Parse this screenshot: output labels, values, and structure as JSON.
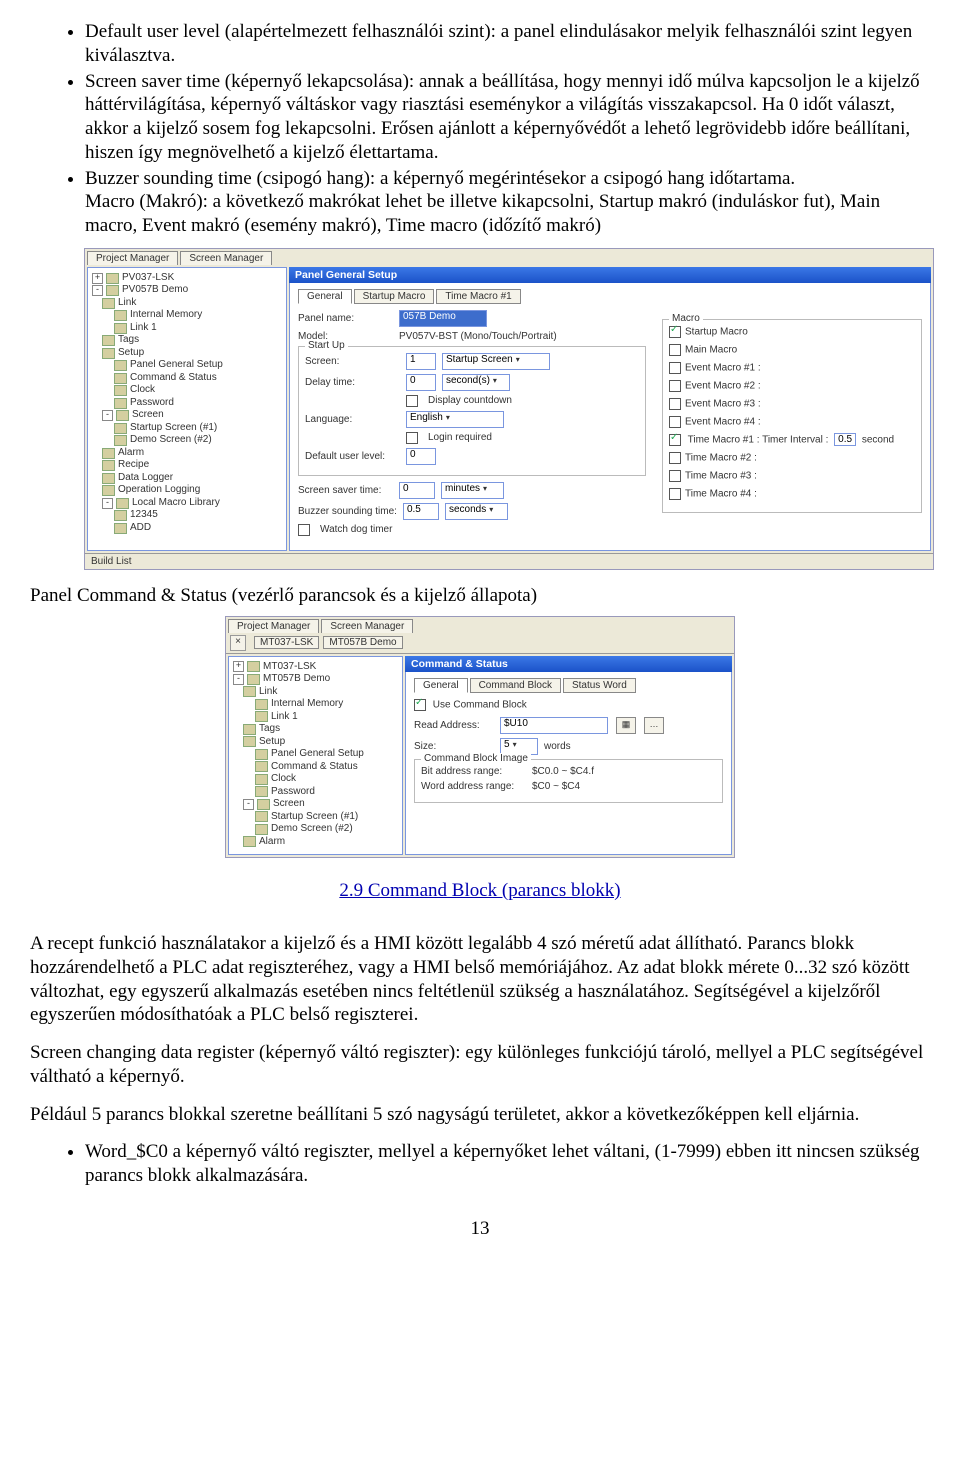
{
  "bullets": {
    "b1": "Default user level (alapértelmezett felhasználói szint): a panel elindulásakor melyik felhasználói szint legyen kiválasztva.",
    "b2": "Screen saver time (képernyő lekapcsolása): annak a beállítása, hogy mennyi idő múlva kapcsoljon le a kijelző háttérvilágítása, képernyő váltáskor vagy riasztási eseménykor a világítás visszakapcsol. Ha 0 időt választ, akkor a kijelző sosem fog lekapcsolni. Erősen ajánlott a képernyővédőt a lehető legrövidebb időre beállítani, hiszen így megnövelhető a kijelző élettartama.",
    "b3": "Buzzer sounding time (csipogó hang): a képernyő megérintésekor a csipogó hang időtartama.",
    "b3_extra": "Macro (Makró): a következő makrókat lehet be illetve kikapcsolni, Startup makró (induláskor fut), Main macro, Event makró (esemény makró), Time macro (időzítő makró)"
  },
  "shot1": {
    "outer_tabs": [
      "Project Manager",
      "Screen Manager"
    ],
    "tree": [
      {
        "t": "PV037-LSK",
        "ind": 0,
        "exp": "+"
      },
      {
        "t": "PV057B Demo",
        "ind": 0,
        "exp": "-"
      },
      {
        "t": "Link",
        "ind": 1
      },
      {
        "t": "Internal Memory",
        "ind": 2
      },
      {
        "t": "Link 1",
        "ind": 2
      },
      {
        "t": "Tags",
        "ind": 1
      },
      {
        "t": "Setup",
        "ind": 1
      },
      {
        "t": "Panel General Setup",
        "ind": 2
      },
      {
        "t": "Command & Status",
        "ind": 2
      },
      {
        "t": "Clock",
        "ind": 2
      },
      {
        "t": "Password",
        "ind": 2
      },
      {
        "t": "Screen",
        "ind": 1,
        "exp": "-"
      },
      {
        "t": "Startup Screen (#1)",
        "ind": 2
      },
      {
        "t": "Demo Screen (#2)",
        "ind": 2
      },
      {
        "t": "Alarm",
        "ind": 1
      },
      {
        "t": "Recipe",
        "ind": 1
      },
      {
        "t": "Data Logger",
        "ind": 1
      },
      {
        "t": "Operation Logging",
        "ind": 1
      },
      {
        "t": "Local Macro Library",
        "ind": 1,
        "exp": "-"
      },
      {
        "t": "12345",
        "ind": 2
      },
      {
        "t": "ADD",
        "ind": 2
      }
    ],
    "build": "Build List",
    "title": "Panel General Setup",
    "inner_tabs": [
      "General",
      "Startup Macro",
      "Time Macro #1"
    ],
    "panel_name_lbl": "Panel name:",
    "panel_name_val": "057B Demo",
    "model_lbl": "Model:",
    "model_val": "PV057V-BST (Mono/Touch/Portrait)",
    "startup_grp": "Start Up",
    "screen_lbl": "Screen:",
    "screen_val": "1",
    "screen_drop": "Startup Screen",
    "delay_lbl": "Delay time:",
    "delay_val": "0",
    "delay_unit": "second(s)",
    "disp_cd": "Display countdown",
    "lang_lbl": "Language:",
    "lang_val": "English",
    "login_req": "Login required",
    "def_lbl": "Default user level:",
    "def_val": "0",
    "sst_lbl": "Screen saver time:",
    "sst_val": "0",
    "sst_unit": "minutes",
    "bst_lbl": "Buzzer sounding time:",
    "bst_val": "0.5",
    "bst_unit": "seconds",
    "wdt": "Watch dog timer",
    "macro_grp": "Macro",
    "m_startup": "Startup Macro",
    "m_main": "Main Macro",
    "m_e1": "Event Macro #1 :",
    "m_e2": "Event Macro #2 :",
    "m_e3": "Event Macro #3 :",
    "m_e4": "Event Macro #4 :",
    "m_t1": "Time Macro #1 : Timer Interval :",
    "m_t1_val": "0.5",
    "m_t1_unit": "second",
    "m_t2": "Time Macro #2 :",
    "m_t3": "Time Macro #3 :",
    "m_t4": "Time Macro #4 :"
  },
  "mid_heading": "Panel Command & Status (vezérlő parancsok és a kijelző állapota)",
  "shot2": {
    "outer_tabs": [
      "Project Manager",
      "Screen Manager"
    ],
    "path": [
      "MT037-LSK",
      "MT057B Demo"
    ],
    "tree": [
      {
        "t": "MT037-LSK",
        "ind": 0,
        "exp": "+"
      },
      {
        "t": "MT057B Demo",
        "ind": 0,
        "exp": "-"
      },
      {
        "t": "Link",
        "ind": 1
      },
      {
        "t": "Internal Memory",
        "ind": 2
      },
      {
        "t": "Link 1",
        "ind": 2
      },
      {
        "t": "Tags",
        "ind": 1
      },
      {
        "t": "Setup",
        "ind": 1
      },
      {
        "t": "Panel General Setup",
        "ind": 2
      },
      {
        "t": "Command & Status",
        "ind": 2
      },
      {
        "t": "Clock",
        "ind": 2
      },
      {
        "t": "Password",
        "ind": 2
      },
      {
        "t": "Screen",
        "ind": 1,
        "exp": "-"
      },
      {
        "t": "Startup Screen (#1)",
        "ind": 2
      },
      {
        "t": "Demo Screen (#2)",
        "ind": 2
      },
      {
        "t": "Alarm",
        "ind": 1
      }
    ],
    "title": "Command & Status",
    "inner_tabs": [
      "General",
      "Command Block",
      "Status Word"
    ],
    "use_cb": "Use Command Block",
    "ra_lbl": "Read Address:",
    "ra_val": "$U10",
    "size_lbl": "Size:",
    "size_val": "5",
    "size_unit": "words",
    "cbi_grp": "Command Block Image",
    "bar_lbl": "Bit address range:",
    "bar_val": "$C0.0 ~ $C4.f",
    "war_lbl": "Word address range:",
    "war_val": "$C0 ~ $C4"
  },
  "subheading": "2.9 Command Block (parancs blokk)",
  "para1": "A recept funkció használatakor a kijelző és a HMI között legalább 4 szó méretű adat állítható. Parancs blokk hozzárendelhető a PLC adat regiszteréhez, vagy a HMI belső memóriájához. Az adat blokk mérete 0...32 szó között változhat, egy egyszerű alkalmazás esetében nincs feltétlenül szükség a használatához. Segítségével a kijelzőről egyszerűen módosíthatóak a PLC belső regiszterei.",
  "para2": "Screen changing data register (képernyő váltó regiszter): egy különleges funkciójú tároló, mellyel a PLC segítségével váltható a képernyő.",
  "para3": "Például 5 parancs blokkal szeretne beállítani 5 szó nagyságú területet, akkor a következőképpen kell eljárnia.",
  "bullets2": {
    "b1": "Word_$C0 a képernyő váltó regiszter, mellyel a képernyőket lehet váltani, (1-7999) ebben itt nincsen szükség parancs blokk alkalmazására."
  },
  "pagenum": "13"
}
